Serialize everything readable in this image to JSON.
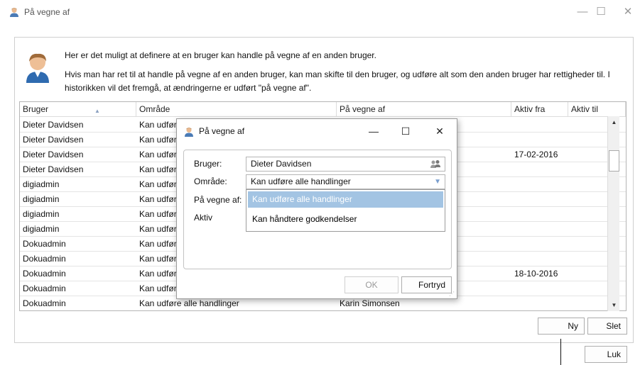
{
  "window": {
    "title": "På vegne af",
    "controls": {
      "minimize": "—",
      "maximize": "☐",
      "close": "✕"
    }
  },
  "info": {
    "line1": "Her er det muligt at definere at en bruger kan handle på vegne af en anden bruger.",
    "line2": "Hvis man har ret til at handle på vegne af en anden bruger, kan man skifte til den bruger, og udføre alt som den anden bruger har rettigheder til. I",
    "line3": "historikken vil det fremgå, at ændringerne er udført \"på vegne af\"."
  },
  "grid": {
    "columns": [
      "Bruger",
      "Område",
      "På vegne af",
      "Aktiv fra",
      "Aktiv til"
    ],
    "rows": [
      [
        "Dieter Davidsen",
        "Kan udfør",
        "",
        "",
        ""
      ],
      [
        "Dieter Davidsen",
        "Kan udfør",
        "",
        "",
        ""
      ],
      [
        "Dieter Davidsen",
        "Kan udfør",
        "",
        "17-02-2016",
        ""
      ],
      [
        "Dieter Davidsen",
        "Kan udfør",
        "",
        "",
        ""
      ],
      [
        "digiadmin",
        "Kan udfør",
        "",
        "",
        ""
      ],
      [
        "digiadmin",
        "Kan udfør",
        "",
        "",
        ""
      ],
      [
        "digiadmin",
        "Kan udfør",
        "",
        "",
        ""
      ],
      [
        "digiadmin",
        "Kan udfør",
        "",
        "",
        ""
      ],
      [
        "Dokuadmin",
        "Kan udfør",
        "",
        "",
        ""
      ],
      [
        "Dokuadmin",
        "Kan udfør",
        "",
        "",
        ""
      ],
      [
        "Dokuadmin",
        "Kan udfør",
        "",
        "18-10-2016",
        ""
      ],
      [
        "Dokuadmin",
        "Kan udfør",
        "",
        "",
        ""
      ],
      [
        "Dokuadmin",
        "Kan udføre alle handlinger",
        "Karin Simonsen",
        "",
        ""
      ]
    ]
  },
  "buttons": {
    "new": "Ny",
    "delete": "Slet",
    "close": "Luk"
  },
  "dialog": {
    "title": "På vegne af",
    "controls": {
      "minimize": "—",
      "maximize": "☐",
      "close": "✕"
    },
    "labels": {
      "user": "Bruger:",
      "area": "Område:",
      "on_behalf": "På vegne af:",
      "active": "Aktiv"
    },
    "user_value": "Dieter Davidsen",
    "area_value": "Kan udføre alle handlinger",
    "dropdown_options": [
      "Kan udføre alle handlinger",
      "Kan håndtere godkendelser"
    ],
    "ok": "OK",
    "cancel": "Fortryd"
  }
}
